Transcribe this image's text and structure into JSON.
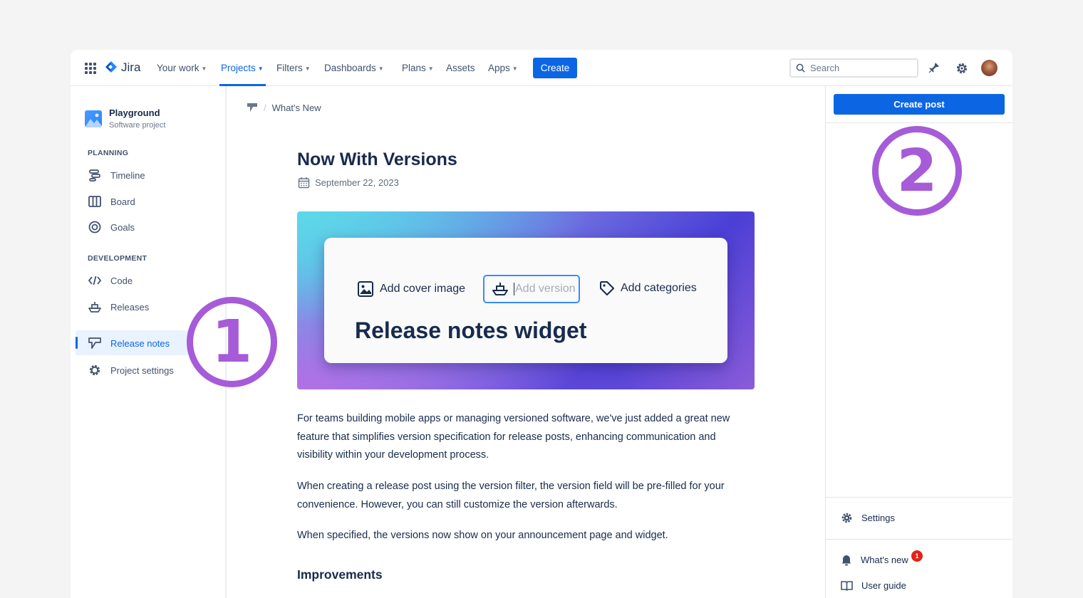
{
  "app": {
    "name": "Jira"
  },
  "nav": {
    "items": [
      {
        "label": "Your work",
        "chevron": true
      },
      {
        "label": "Projects",
        "chevron": true,
        "active": true
      },
      {
        "label": "Filters",
        "chevron": true
      },
      {
        "label": "Dashboards",
        "chevron": true
      },
      {
        "label": "Plans",
        "chevron": true
      },
      {
        "label": "Assets",
        "chevron": false
      },
      {
        "label": "Apps",
        "chevron": true
      }
    ],
    "create_label": "Create",
    "search_placeholder": "Search"
  },
  "sidebar": {
    "project_name": "Playground",
    "project_type": "Software project",
    "planning_label": "PLANNING",
    "development_label": "DEVELOPMENT",
    "items": {
      "timeline": "Timeline",
      "board": "Board",
      "goals": "Goals",
      "code": "Code",
      "releases": "Releases",
      "release_notes": "Release notes",
      "project_settings": "Project settings"
    }
  },
  "main": {
    "breadcrumb": "What's New",
    "title": "Now With Versions",
    "date": "September 22, 2023",
    "hero": {
      "add_cover": "Add cover image",
      "add_version": "Add version",
      "add_categories": "Add categories",
      "title": "Release notes widget"
    },
    "paragraphs": [
      "For teams building mobile apps or managing versioned software, we've just added a great new feature that simplifies version specification for release posts, enhancing communication and visibility within your development process.",
      "When creating a release post using the version filter, the version field will be pre-filled for your convenience. However, you can still customize the version afterwards.",
      "When specified, the versions now show on your announcement page and widget."
    ],
    "improvements_heading": "Improvements"
  },
  "right_panel": {
    "create_post": "Create post",
    "settings": "Settings",
    "whats_new": "What's new",
    "whats_new_badge": "1",
    "user_guide": "User guide"
  },
  "callouts": {
    "one": "1",
    "two": "2"
  },
  "colors": {
    "accent": "#0c66e4",
    "callout": "#a65bd8",
    "badge": "#e2231a"
  }
}
